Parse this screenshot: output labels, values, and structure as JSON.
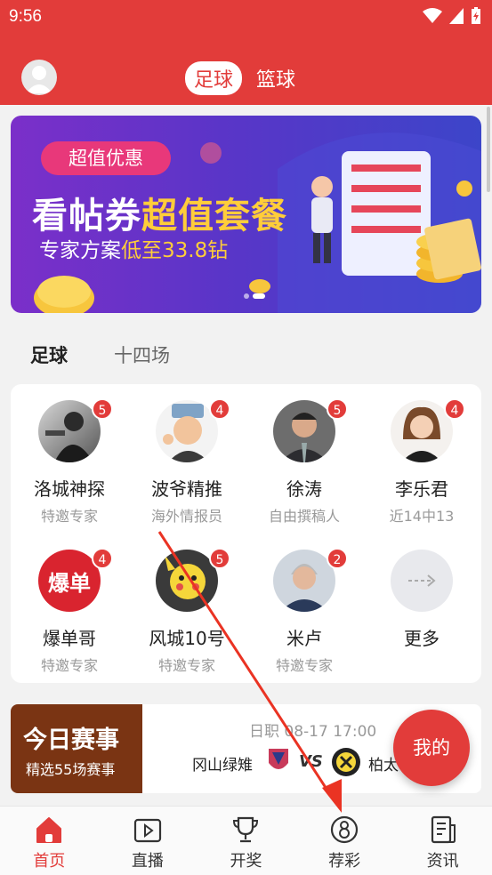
{
  "status_bar": {
    "time": "9:56"
  },
  "header": {
    "sport_tabs": [
      {
        "label": "足球",
        "active": true
      },
      {
        "label": "篮球",
        "active": false
      }
    ]
  },
  "banner": {
    "pill": "超值优惠",
    "headline_a": "看帖券",
    "headline_b": "超值套餐",
    "sub_a": "专家方案",
    "sub_b": "低至33.8钻"
  },
  "sub_tabs": [
    {
      "label": "足球",
      "active": true
    },
    {
      "label": "十四场",
      "active": false
    }
  ],
  "experts": [
    {
      "name": "洛城神探",
      "desc": "特邀专家",
      "badge": "5"
    },
    {
      "name": "波爷精推",
      "desc": "海外情报员",
      "badge": "4"
    },
    {
      "name": "徐涛",
      "desc": "自由撰稿人",
      "badge": "5"
    },
    {
      "name": "李乐君",
      "desc": "近14中13",
      "badge": "4"
    },
    {
      "name": "爆单哥",
      "desc": "特邀专家",
      "badge": "4",
      "avatar_text": "爆单"
    },
    {
      "name": "风城10号",
      "desc": "特邀专家",
      "badge": "5"
    },
    {
      "name": "米卢",
      "desc": "特邀专家",
      "badge": "2"
    }
  ],
  "more_label": "更多",
  "match": {
    "title": "今日赛事",
    "subtitle": "精选55场赛事",
    "info": "日职 08-17 17:00",
    "home": "冈山绿雉",
    "vs": "VS",
    "away": "柏太"
  },
  "fab_label": "我的",
  "bottom_nav": [
    {
      "label": "首页",
      "icon": "home-icon",
      "active": true
    },
    {
      "label": "直播",
      "icon": "play-icon",
      "active": false
    },
    {
      "label": "开奖",
      "icon": "trophy-icon",
      "active": false
    },
    {
      "label": "荐彩",
      "icon": "lottery-8-icon",
      "active": false
    },
    {
      "label": "资讯",
      "icon": "news-icon",
      "active": false
    }
  ],
  "colors": {
    "brand": "#e23c3a",
    "banner_start": "#7b2fc9",
    "banner_end": "#3c45c9",
    "match_brown": "#7a3413"
  }
}
